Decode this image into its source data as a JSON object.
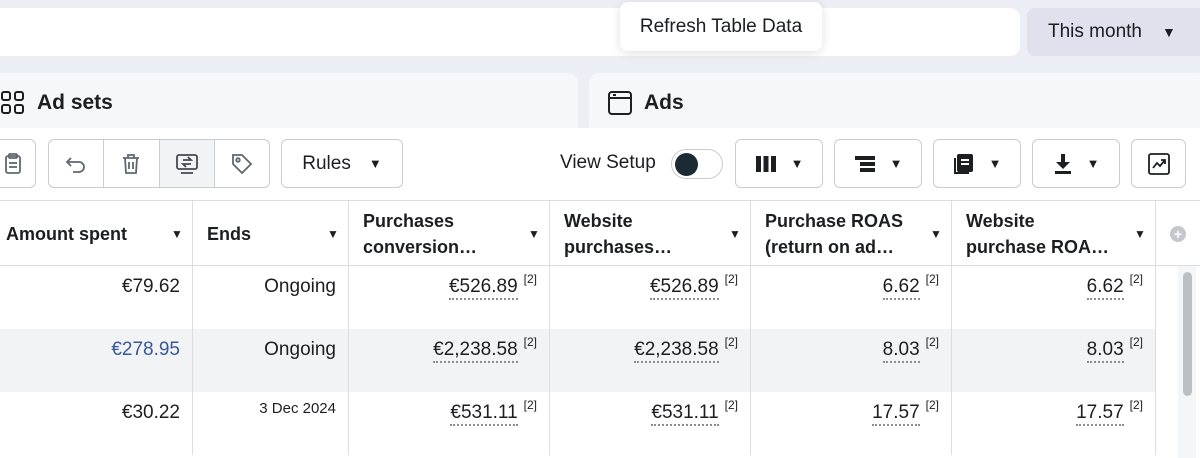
{
  "date_range": {
    "label": "This month"
  },
  "tooltip": {
    "text": "Refresh Table Data"
  },
  "tabs": [
    {
      "label": "Ad sets",
      "icon": "grid-icon"
    },
    {
      "label": "Ads",
      "icon": "ad-frame-icon"
    }
  ],
  "toolbar": {
    "rules_label": "Rules",
    "view_setup_label": "View Setup",
    "view_setup_on": false
  },
  "table": {
    "columns": [
      {
        "label": "Amount spent"
      },
      {
        "label": "Ends"
      },
      {
        "label": "Purchases\nconversion…"
      },
      {
        "label": "Website\npurchases…"
      },
      {
        "label": "Purchase ROAS\n(return on ad…"
      },
      {
        "label": "Website\npurchase ROA…"
      }
    ],
    "rows": [
      {
        "amount_spent": "€79.62",
        "ends": "Ongoing",
        "purchases_conversion": "€526.89",
        "website_purchases": "€526.89",
        "purchase_roas": "6.62",
        "website_purchase_roas": "6.62",
        "note": "[2]"
      },
      {
        "amount_spent": "€278.95",
        "ends": "Ongoing",
        "purchases_conversion": "€2,238.58",
        "website_purchases": "€2,238.58",
        "purchase_roas": "8.03",
        "website_purchase_roas": "8.03",
        "note": "[2]"
      },
      {
        "amount_spent": "€30.22",
        "ends": "3 Dec 2024",
        "purchases_conversion": "€531.11",
        "website_purchases": "€531.11",
        "purchase_roas": "17.57",
        "website_purchase_roas": "17.57",
        "note": "[2]"
      }
    ]
  },
  "colors": {
    "link": "#385898",
    "alt_row": "#f2f3f5",
    "date_select_bg": "#dfe2ec"
  }
}
